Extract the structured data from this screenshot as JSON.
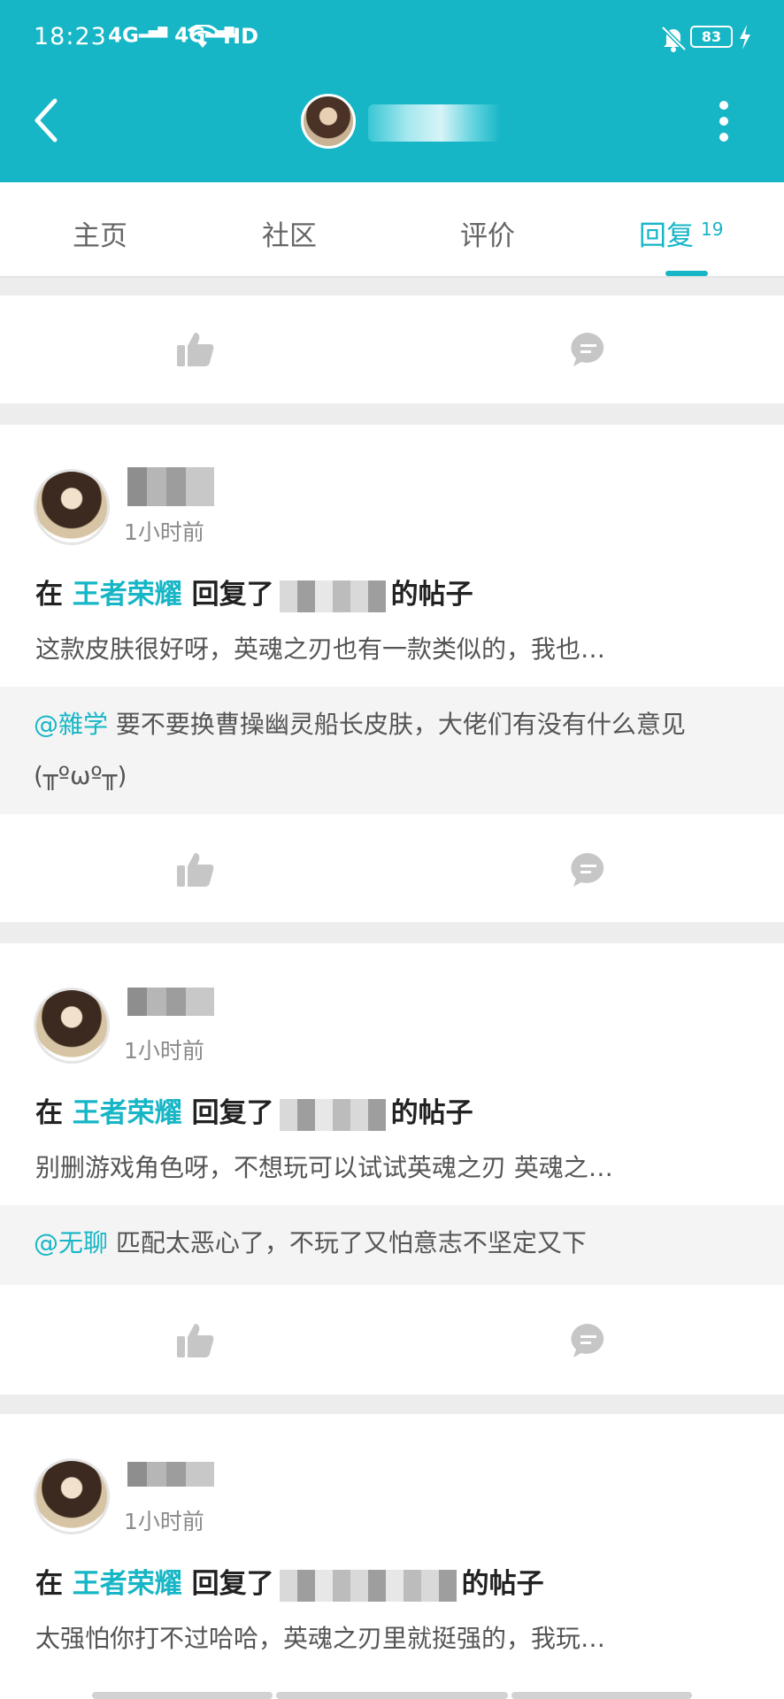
{
  "status_bar": {
    "time": "18:23",
    "network": "4G",
    "hd": "HD",
    "battery": "83"
  },
  "tabs": [
    {
      "label": "主页"
    },
    {
      "label": "社区"
    },
    {
      "label": "评价"
    },
    {
      "label": "回复",
      "count": "19",
      "active": true
    }
  ],
  "posts": [
    {
      "time": "1小时前",
      "prefix": "在",
      "game": "王者荣耀",
      "action": "回复了",
      "suffix": "的帖子",
      "excerpt": "这款皮肤很好呀，英魂之刃也有一款类似的，我也…",
      "quote_user": "@雜学",
      "quote": " 要不要换曹操幽灵船长皮肤，大佬们有没有什么意见(╥ºωº╥)"
    },
    {
      "time": "1小时前",
      "prefix": "在",
      "game": "王者荣耀",
      "action": "回复了",
      "suffix": "的帖子",
      "excerpt": "别删游戏角色呀，不想玩可以试试英魂之刃 英魂之…",
      "quote_user": "@无聊",
      "quote": " 匹配太恶心了，不玩了又怕意志不坚定又下"
    },
    {
      "time": "1小时前",
      "prefix": "在",
      "game": "王者荣耀",
      "action": "回复了",
      "suffix": "的帖子",
      "excerpt": "太强怕你打不过哈哈，英魂之刃里就挺强的，我玩…"
    }
  ],
  "icons": {
    "like": "thumbs-up-icon",
    "comment": "comment-icon"
  },
  "colors": {
    "accent": "#16b6c6"
  }
}
